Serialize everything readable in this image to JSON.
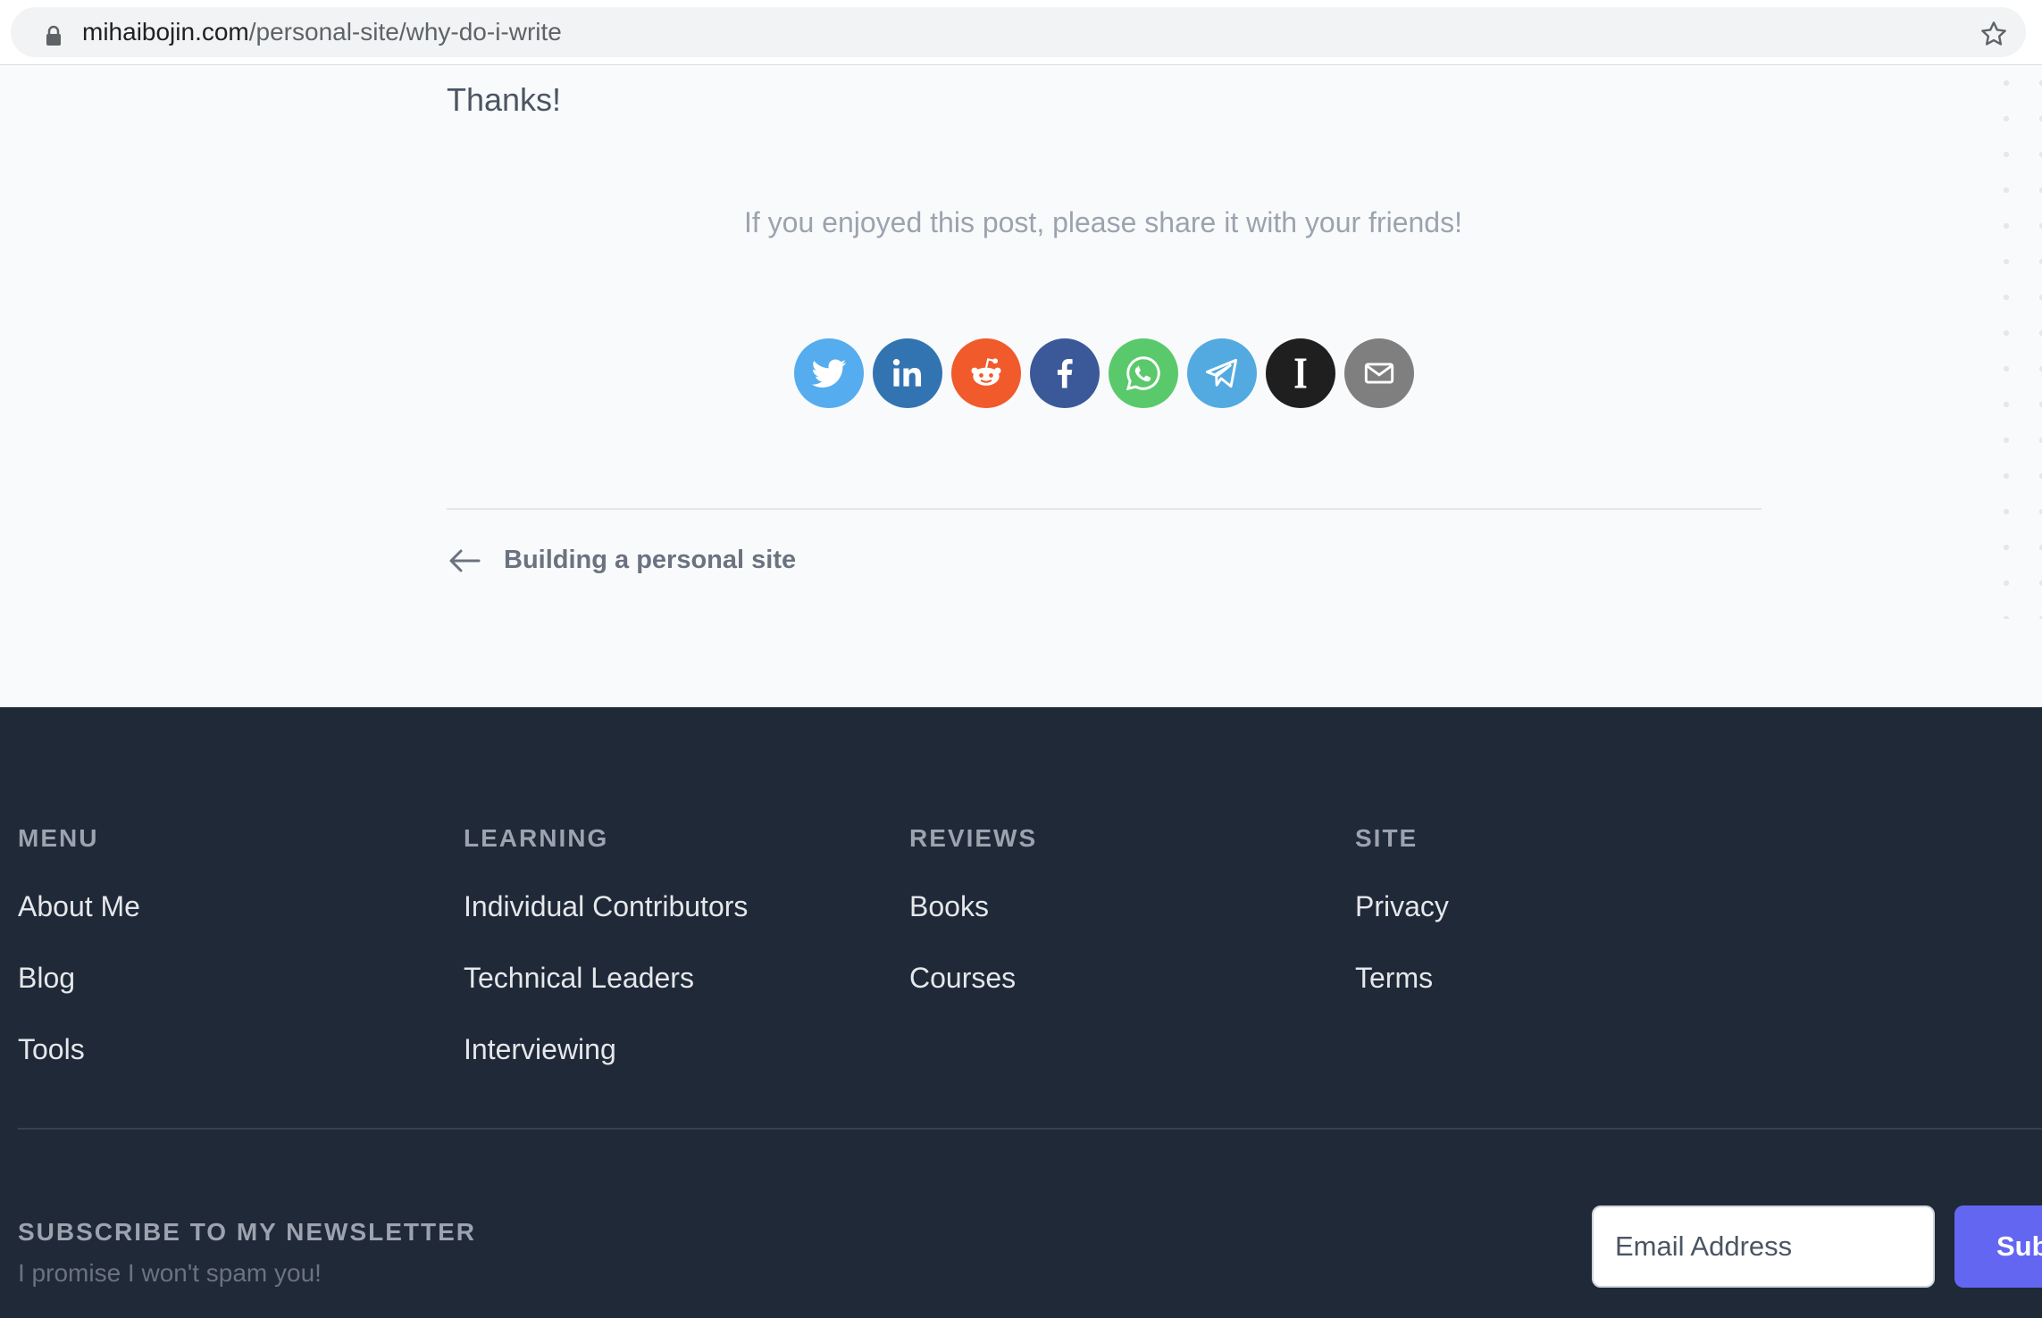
{
  "browser": {
    "url_domain": "mihaibojin.com",
    "url_path": "/personal-site/why-do-i-write",
    "lock_icon": "lock-icon",
    "bookmark_icon": "star-icon"
  },
  "article": {
    "closing_text": "Thanks!",
    "share_prompt": "If you enjoyed this post, please share it with your friends!",
    "share_buttons": [
      {
        "network": "Twitter",
        "icon": "twitter-icon",
        "color": "#55acee"
      },
      {
        "network": "LinkedIn",
        "icon": "linkedin-icon",
        "color": "#3274b2"
      },
      {
        "network": "Reddit",
        "icon": "reddit-icon",
        "color": "#f15a2b"
      },
      {
        "network": "Facebook",
        "icon": "facebook-icon",
        "color": "#3b5998"
      },
      {
        "network": "WhatsApp",
        "icon": "whatsapp-icon",
        "color": "#5ac96b"
      },
      {
        "network": "Telegram",
        "icon": "telegram-icon",
        "color": "#53aae0"
      },
      {
        "network": "Instapaper",
        "icon": "instapaper-icon",
        "color": "#1f1f1f"
      },
      {
        "network": "Email",
        "icon": "email-icon",
        "color": "#7f7f7f"
      }
    ],
    "previous_post": {
      "label": "Building a personal site",
      "icon": "arrow-left-icon"
    }
  },
  "footer": {
    "columns": [
      {
        "heading": "MENU",
        "links": [
          "About Me",
          "Blog",
          "Tools"
        ]
      },
      {
        "heading": "LEARNING",
        "links": [
          "Individual Contributors",
          "Technical Leaders",
          "Interviewing"
        ]
      },
      {
        "heading": "REVIEWS",
        "links": [
          "Books",
          "Courses"
        ]
      },
      {
        "heading": "SITE",
        "links": [
          "Privacy",
          "Terms"
        ]
      }
    ],
    "newsletter": {
      "title": "SUBSCRIBE TO MY NEWSLETTER",
      "subtitle": "I promise I won't spam you!",
      "email_placeholder": "Email Address",
      "button_label": "Subscribe"
    }
  },
  "colors": {
    "page_background": "#f9fafb",
    "footer_background": "#1f2937",
    "accent": "#6366f1"
  }
}
